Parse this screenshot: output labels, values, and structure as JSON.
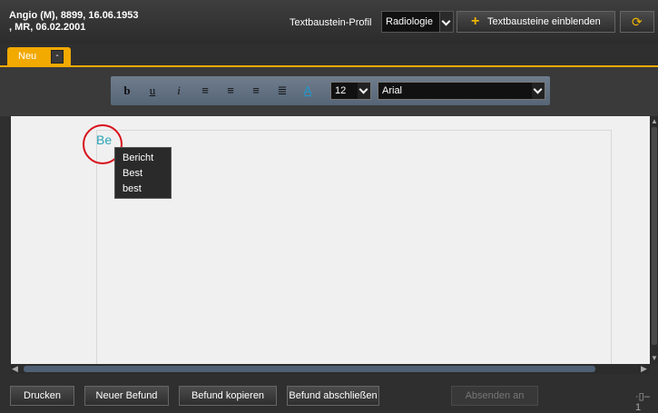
{
  "header": {
    "patient_line1": "Angio (M), 8899, 16.06.1953",
    "patient_line2": ", MR, 06.02.2001",
    "profile_label": "Textbaustein-Profil",
    "profile_value": "Radiologie",
    "show_button": "Textbausteine einblenden"
  },
  "tabs": [
    {
      "label": "Neu"
    }
  ],
  "toolbar": {
    "font_size": "12",
    "font_family": "Arial",
    "icons": [
      "bold-icon",
      "underline-icon",
      "italic-icon",
      "align-left-icon",
      "align-center-icon",
      "align-right-icon",
      "justify-icon",
      "text-color-icon"
    ]
  },
  "editor": {
    "typed_text": "Be",
    "suggestions": [
      "Bericht",
      "Best",
      "best"
    ]
  },
  "bottom": {
    "print": "Drucken",
    "new": "Neuer Befund",
    "copy": "Befund kopieren",
    "close": "Befund abschließen",
    "send": "Absenden an",
    "page_indicator": "1"
  },
  "colors": {
    "accent": "#f2a900",
    "typed_text": "#2aa3b6",
    "highlight_circle": "#d8101a"
  }
}
